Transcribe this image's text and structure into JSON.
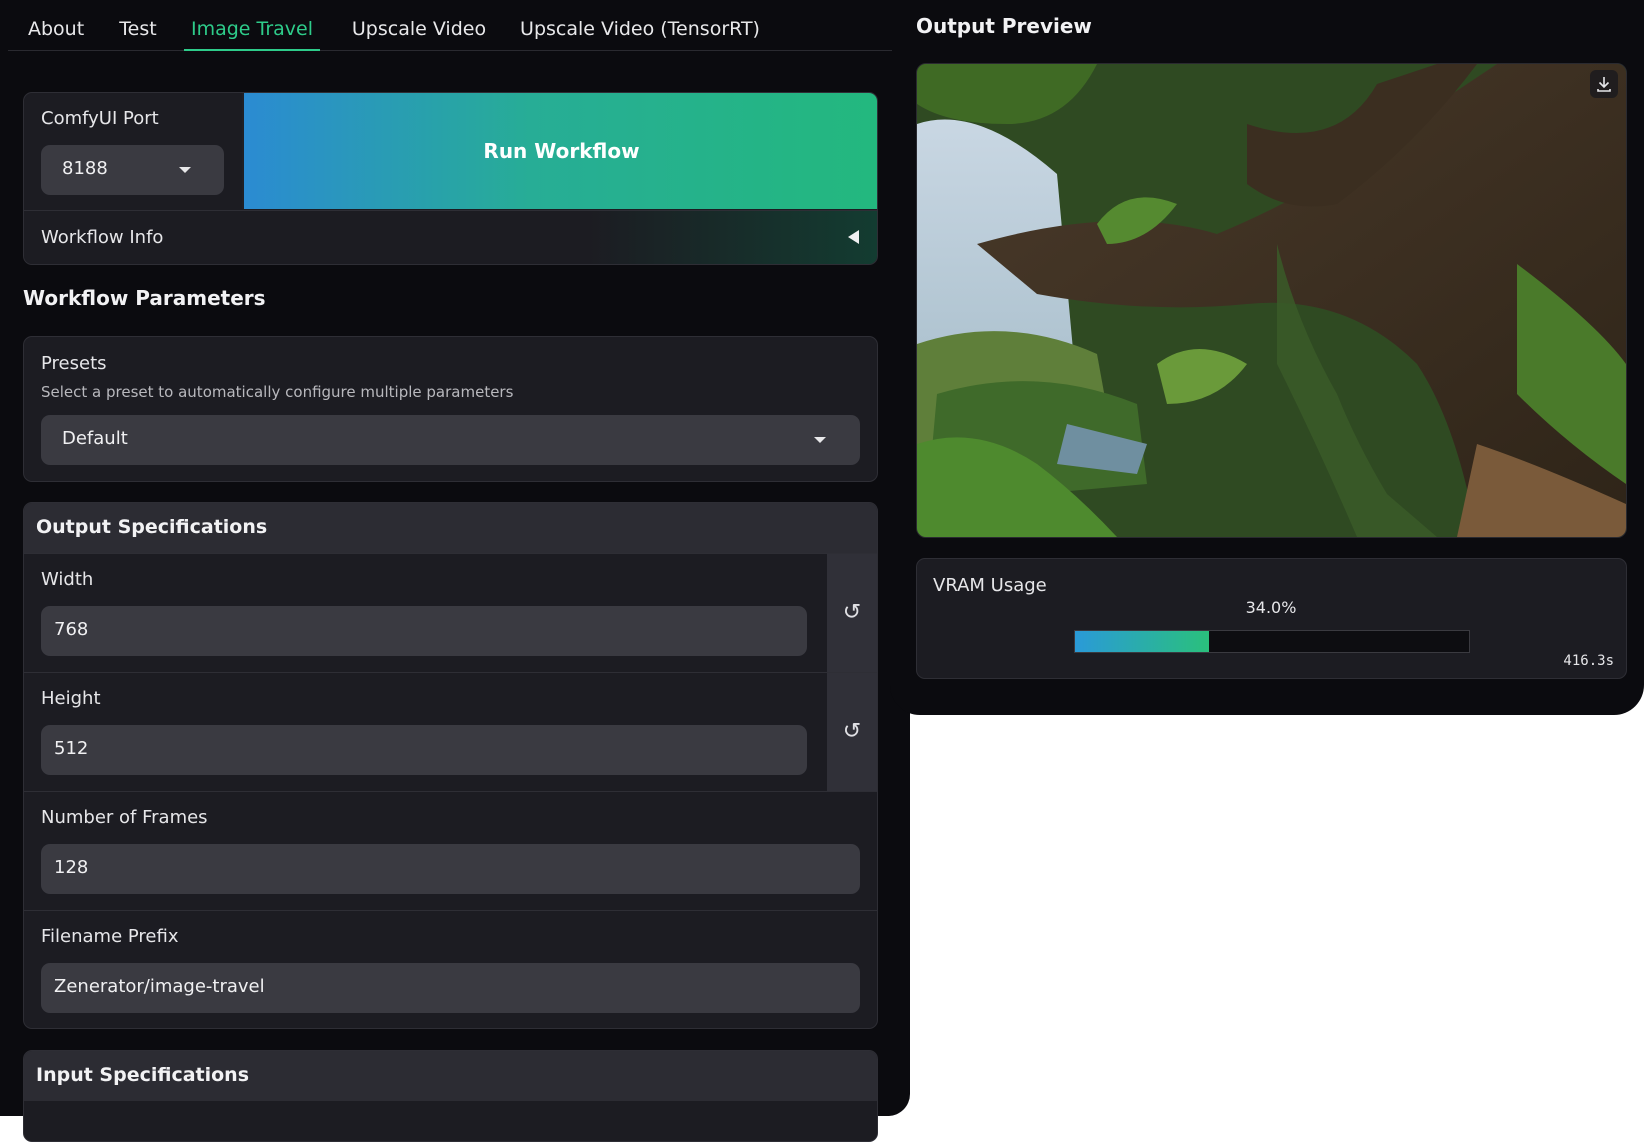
{
  "tabs": [
    "About",
    "Test",
    "Image Travel",
    "Upscale Video",
    "Upscale Video (TensorRT)"
  ],
  "active_tab": "Image Travel",
  "run": {
    "port_label": "ComfyUI Port",
    "port_value": "8188",
    "button_label": "Run Workflow",
    "info_label": "Workflow Info"
  },
  "params": {
    "title": "Workflow Parameters",
    "presets": {
      "label": "Presets",
      "hint": "Select a preset to automatically configure multiple parameters",
      "value": "Default"
    },
    "output_spec": {
      "title": "Output Specifications",
      "width_label": "Width",
      "width_value": "768",
      "height_label": "Height",
      "height_value": "512",
      "frames_label": "Number of Frames",
      "frames_value": "128",
      "prefix_label": "Filename Prefix",
      "prefix_value": "Zenerator/image-travel"
    },
    "input_spec": {
      "title": "Input Specifications"
    }
  },
  "preview": {
    "title": "Output Preview",
    "image_icon": "download-icon"
  },
  "vram": {
    "label": "VRAM Usage",
    "percent_text": "34.0%",
    "fraction": 0.34,
    "time": "416.3s",
    "colors": {
      "start": "#2a9ad8",
      "end": "#2ac07c"
    }
  },
  "colors": {
    "accent": "#2ecc8a",
    "bg": "#0b0b0f",
    "panel": "#1c1c22",
    "field": "#3a3a41"
  }
}
